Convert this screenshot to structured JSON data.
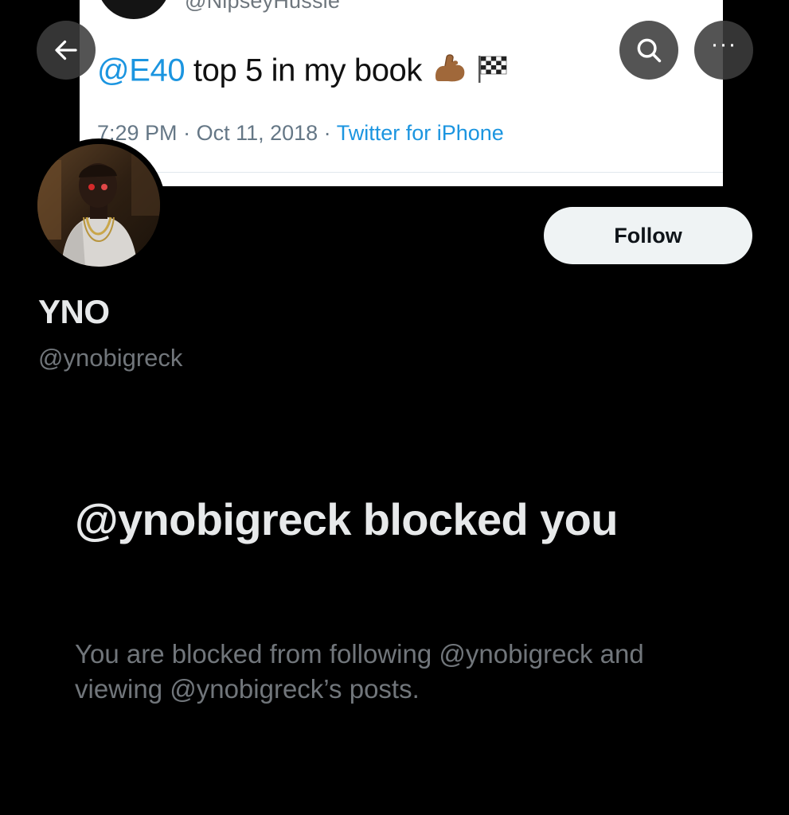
{
  "banner": {
    "top_handle": "@NipseyHussle",
    "tweet_mention": "@E40",
    "tweet_text": " top 5 in my book ",
    "emojis": [
      "flexed-biceps",
      "chequered-flag"
    ],
    "time": "7:29 PM",
    "separator": " · ",
    "date": "Oct 11, 2018",
    "source": "Twitter for iPhone"
  },
  "nav": {
    "back_icon": "arrow-left-icon",
    "search_icon": "search-icon",
    "more_icon": "more-icon",
    "more_glyph": "···"
  },
  "profile": {
    "display_name": "YNO",
    "handle": "@ynobigreck",
    "follow_label": "Follow"
  },
  "blocked": {
    "title": "@ynobigreck blocked you",
    "description": "You are blocked from following @ynobigreck and viewing @ynobigreck’s posts."
  },
  "colors": {
    "background": "#000000",
    "mention_blue": "#1b95e0",
    "secondary_text": "#71767b",
    "primary_text": "#e7e9ea",
    "follow_bg": "#eff3f4"
  }
}
